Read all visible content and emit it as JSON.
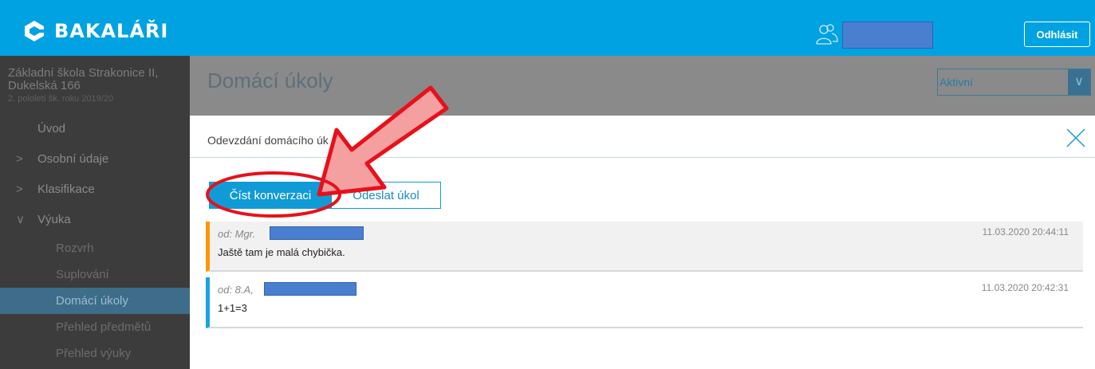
{
  "header": {
    "logo_text": "BAKALÁŘI",
    "logout_label": "Odhlásit"
  },
  "sidebar": {
    "school_line1": "Základní škola Strakonice II,",
    "school_line2": "Dukelská 166",
    "term": "2. pololetí šk. roku 2019/20",
    "items": [
      {
        "label": "Úvod",
        "chevron": ""
      },
      {
        "label": "Osobní údaje",
        "chevron": ">"
      },
      {
        "label": "Klasifikace",
        "chevron": ">"
      },
      {
        "label": "Výuka",
        "chevron": "∨"
      },
      {
        "label": "Rozvrh"
      },
      {
        "label": "Suplování"
      },
      {
        "label": "Domácí úkoly",
        "active": true
      },
      {
        "label": "Přehled předmětů"
      },
      {
        "label": "Přehled výuky"
      }
    ]
  },
  "main": {
    "title": "Domácí úkoly",
    "filter_value": "Aktivní"
  },
  "modal": {
    "title": "Odevzdání domácího úk",
    "read_button": "Číst konverzaci",
    "send_button": "Odeslat úkol",
    "messages": [
      {
        "from": "od: Mgr.",
        "date": "11.03.2020 20:44:11",
        "text": "Jaště tam je malá chybička.",
        "accent": "#ff9600"
      },
      {
        "from": "od: 8.A,",
        "date": "11.03.2020 20:42:31",
        "text": "1+1=3",
        "accent": "#19a3e2"
      }
    ]
  },
  "colors": {
    "topbar": "#00a2e2",
    "sidebar": "#3c3c3c",
    "annotation": "#e8101a",
    "arrow_fill": "#f4a0a0"
  }
}
